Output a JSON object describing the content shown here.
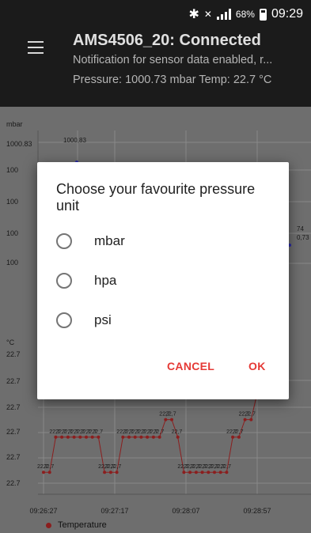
{
  "status_bar": {
    "bluetooth_icon": "bluetooth-icon",
    "mute_icon": "vibrate-mute-icon",
    "battery_percent": "68%",
    "time": "09:29"
  },
  "app_bar": {
    "menu_icon": "hamburger-menu-icon",
    "title": "AMS4506_20: Connected",
    "subtitle": "Notification for sensor data enabled, r...",
    "readout": "Pressure: 1000.73 mbar  Temp: 22.7 °C"
  },
  "dialog": {
    "title": "Choose your favourite pressure unit",
    "options": [
      {
        "label": "mbar",
        "selected": false
      },
      {
        "label": "hpa",
        "selected": false
      },
      {
        "label": "psi",
        "selected": false
      }
    ],
    "cancel_label": "CANCEL",
    "ok_label": "OK",
    "accent_color": "#e53935"
  },
  "chart_data": [
    {
      "type": "line",
      "title": "",
      "ylabel": "mbar",
      "y_tick_labels": [
        "1000.83",
        "100",
        "100",
        "100",
        "100"
      ],
      "annotations": [
        "1000,83",
        "74",
        "0,73"
      ],
      "series": [
        {
          "name": "",
          "color": "#2a2aa8",
          "x": [
            0,
            1,
            2
          ],
          "values": [
            1000.73,
            1000.83,
            1000.73
          ]
        }
      ]
    },
    {
      "type": "line",
      "ylabel": "°C",
      "y_tick_labels": [
        "22.7",
        "22.7",
        "22.7",
        "22.7",
        "22.7",
        "22.7"
      ],
      "x_tick_labels": [
        "09:26:27",
        "09:27:17",
        "09:28:07",
        "09:28:57"
      ],
      "legend_position": "bottom-left",
      "series": [
        {
          "name": "Temperature",
          "color": "#8b1e1e",
          "values": [
            22.6,
            22.6,
            22.68,
            22.68,
            22.68,
            22.68,
            22.68,
            22.68,
            22.68,
            22.68,
            22.6,
            22.6,
            22.6,
            22.68,
            22.68,
            22.68,
            22.68,
            22.68,
            22.68,
            22.68,
            22.72,
            22.72,
            22.68,
            22.6,
            22.6,
            22.6,
            22.6,
            22.6,
            22.6,
            22.6,
            22.6,
            22.68,
            22.68,
            22.72,
            22.72,
            22.78
          ]
        }
      ],
      "data_label": "22,7",
      "data_label_low": "22,7"
    }
  ]
}
